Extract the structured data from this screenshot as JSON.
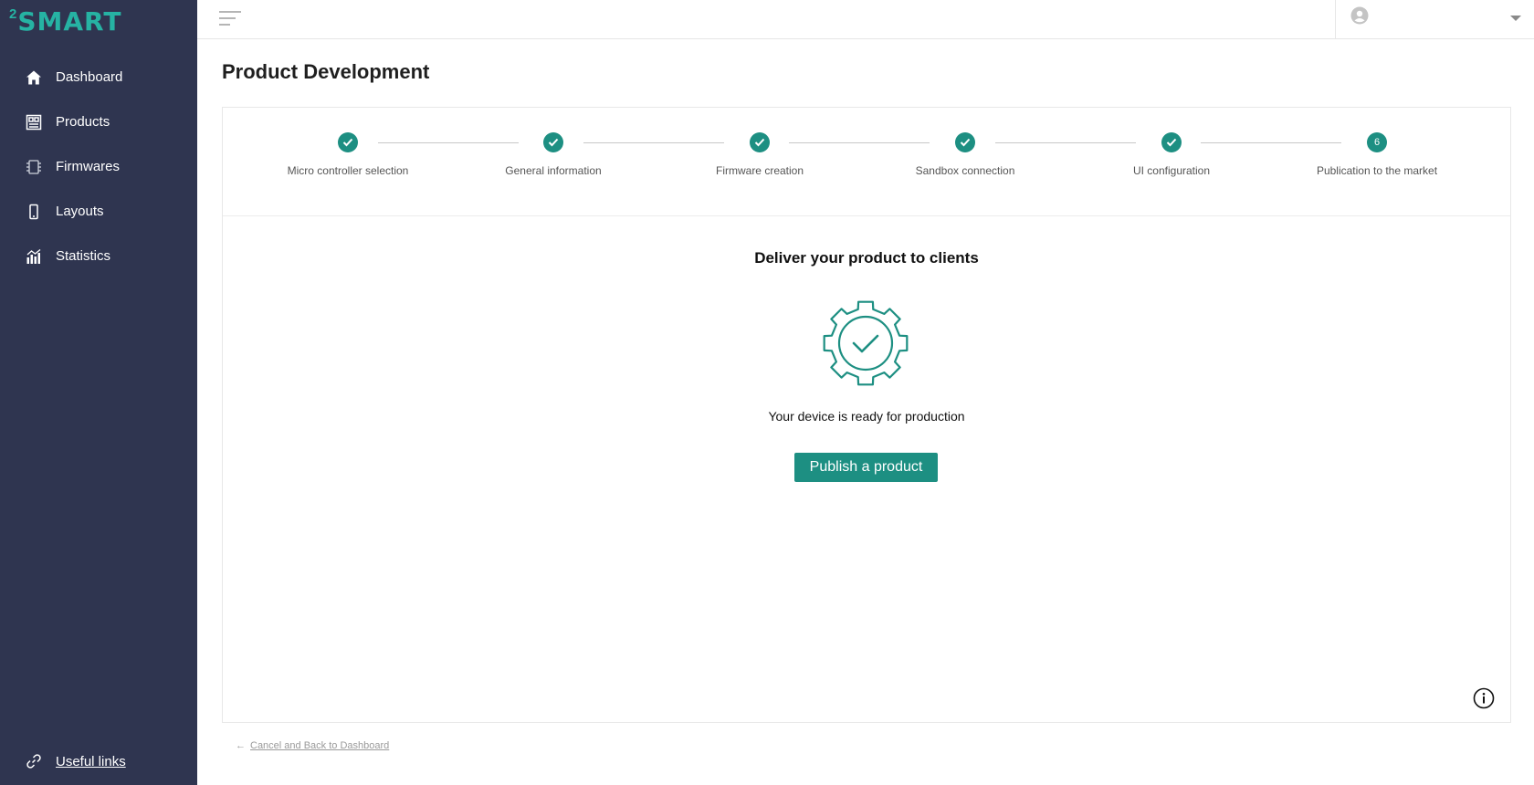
{
  "app": {
    "logo_sup": "2",
    "logo_text": "SMART"
  },
  "sidebar": {
    "items": [
      {
        "label": "Dashboard",
        "icon": "home-icon"
      },
      {
        "label": "Products",
        "icon": "products-icon"
      },
      {
        "label": "Firmwares",
        "icon": "firmware-chip-icon"
      },
      {
        "label": "Layouts",
        "icon": "phone-icon"
      },
      {
        "label": "Statistics",
        "icon": "chart-icon"
      }
    ],
    "useful_links": "Useful links"
  },
  "header": {
    "menu_icon": "hamburger-icon",
    "user_icon": "user-icon"
  },
  "main": {
    "title": "Product Development",
    "steps": [
      {
        "label": "Micro controller selection",
        "done": true
      },
      {
        "label": "General information",
        "done": true
      },
      {
        "label": "Firmware creation",
        "done": true
      },
      {
        "label": "Sandbox connection",
        "done": true
      },
      {
        "label": "UI configuration",
        "done": true
      },
      {
        "label": "Publication to the market",
        "done": false,
        "number": "6"
      }
    ],
    "heading": "Deliver your product to clients",
    "ready_text": "Your device is ready for production",
    "publish_button": "Publish a product",
    "back_link": "Cancel and Back to Dashboard"
  },
  "colors": {
    "sidebar_bg": "#2f3550",
    "accent": "#1d8f82",
    "logo": "#26b3a3"
  }
}
